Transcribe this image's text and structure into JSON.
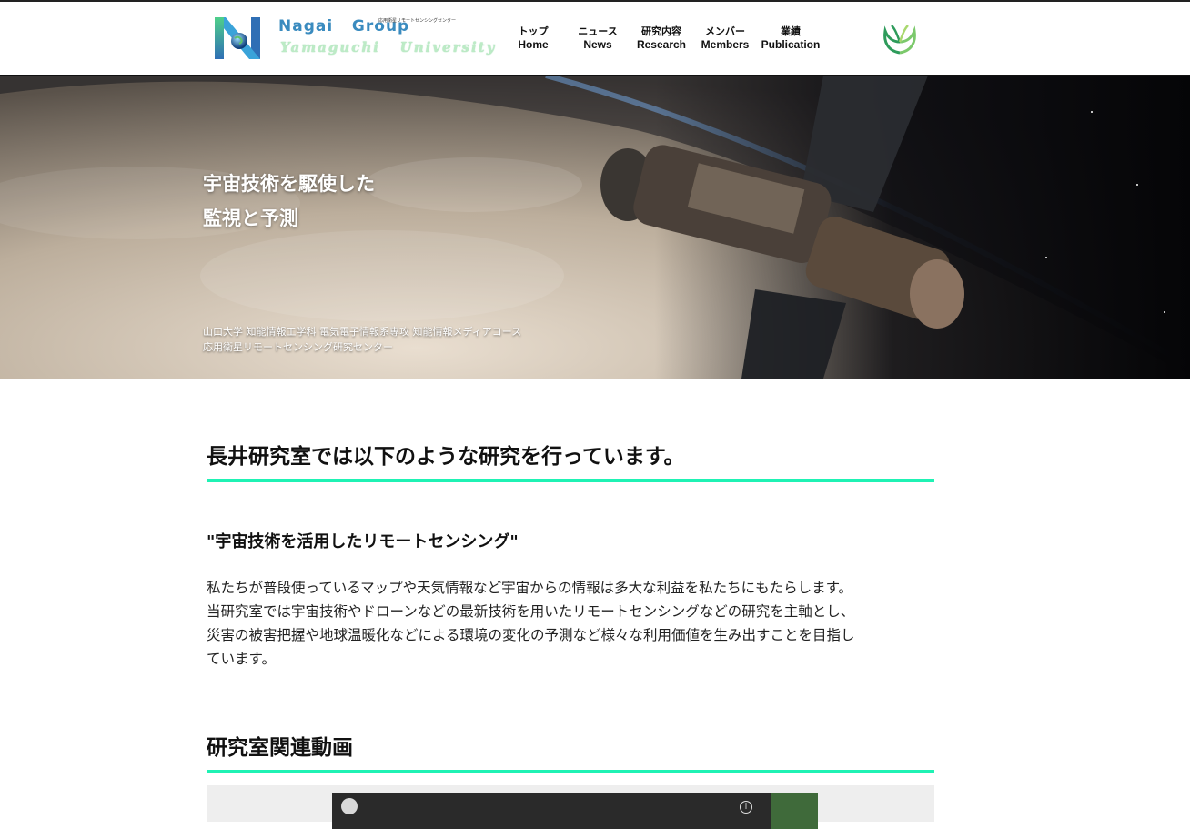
{
  "header": {
    "logo_title": "Nagai   Group",
    "logo_subtitle": "Yamaguchi   University",
    "logo_tagline": "応用衛星リモートセンシングセンター",
    "nav": [
      {
        "jp": "トップ",
        "en": "Home"
      },
      {
        "jp": "ニュース",
        "en": "News"
      },
      {
        "jp": "研究内容",
        "en": "Research"
      },
      {
        "jp": "メンバー",
        "en": "Members"
      },
      {
        "jp": "業績",
        "en": "Publication"
      }
    ]
  },
  "hero": {
    "title_line1": "宇宙技術を駆使した",
    "title_line2": "監視と予測",
    "caption_line1": "山口大学 知能情報工学科 電気電子情報系専攻 知能情報メディアコース",
    "caption_line2": "応用衛星リモートセンシング研究センター"
  },
  "main": {
    "heading": "長井研究室では以下のような研究を行っています。",
    "subheading": "\"宇宙技術を活用したリモートセンシング\"",
    "paragraph_lines": [
      "私たちが普段使っているマップや天気情報など宇宙からの情報は多大な利益を私たちにもたらします。",
      "当研究室では宇宙技術やドローンなどの最新技術を用いたリモートセンシングなどの研究を主軸とし、",
      "災害の被害把握や地球温暖化などによる環境の変化の予測など様々な利用価値を生み出すことを目指し",
      "ています。"
    ],
    "video_heading": "研究室関連動画"
  },
  "colors": {
    "accent_rule": "#1ff2b4",
    "logo_blue": "#3a8bbf",
    "logo_green": "#bdebc6"
  }
}
